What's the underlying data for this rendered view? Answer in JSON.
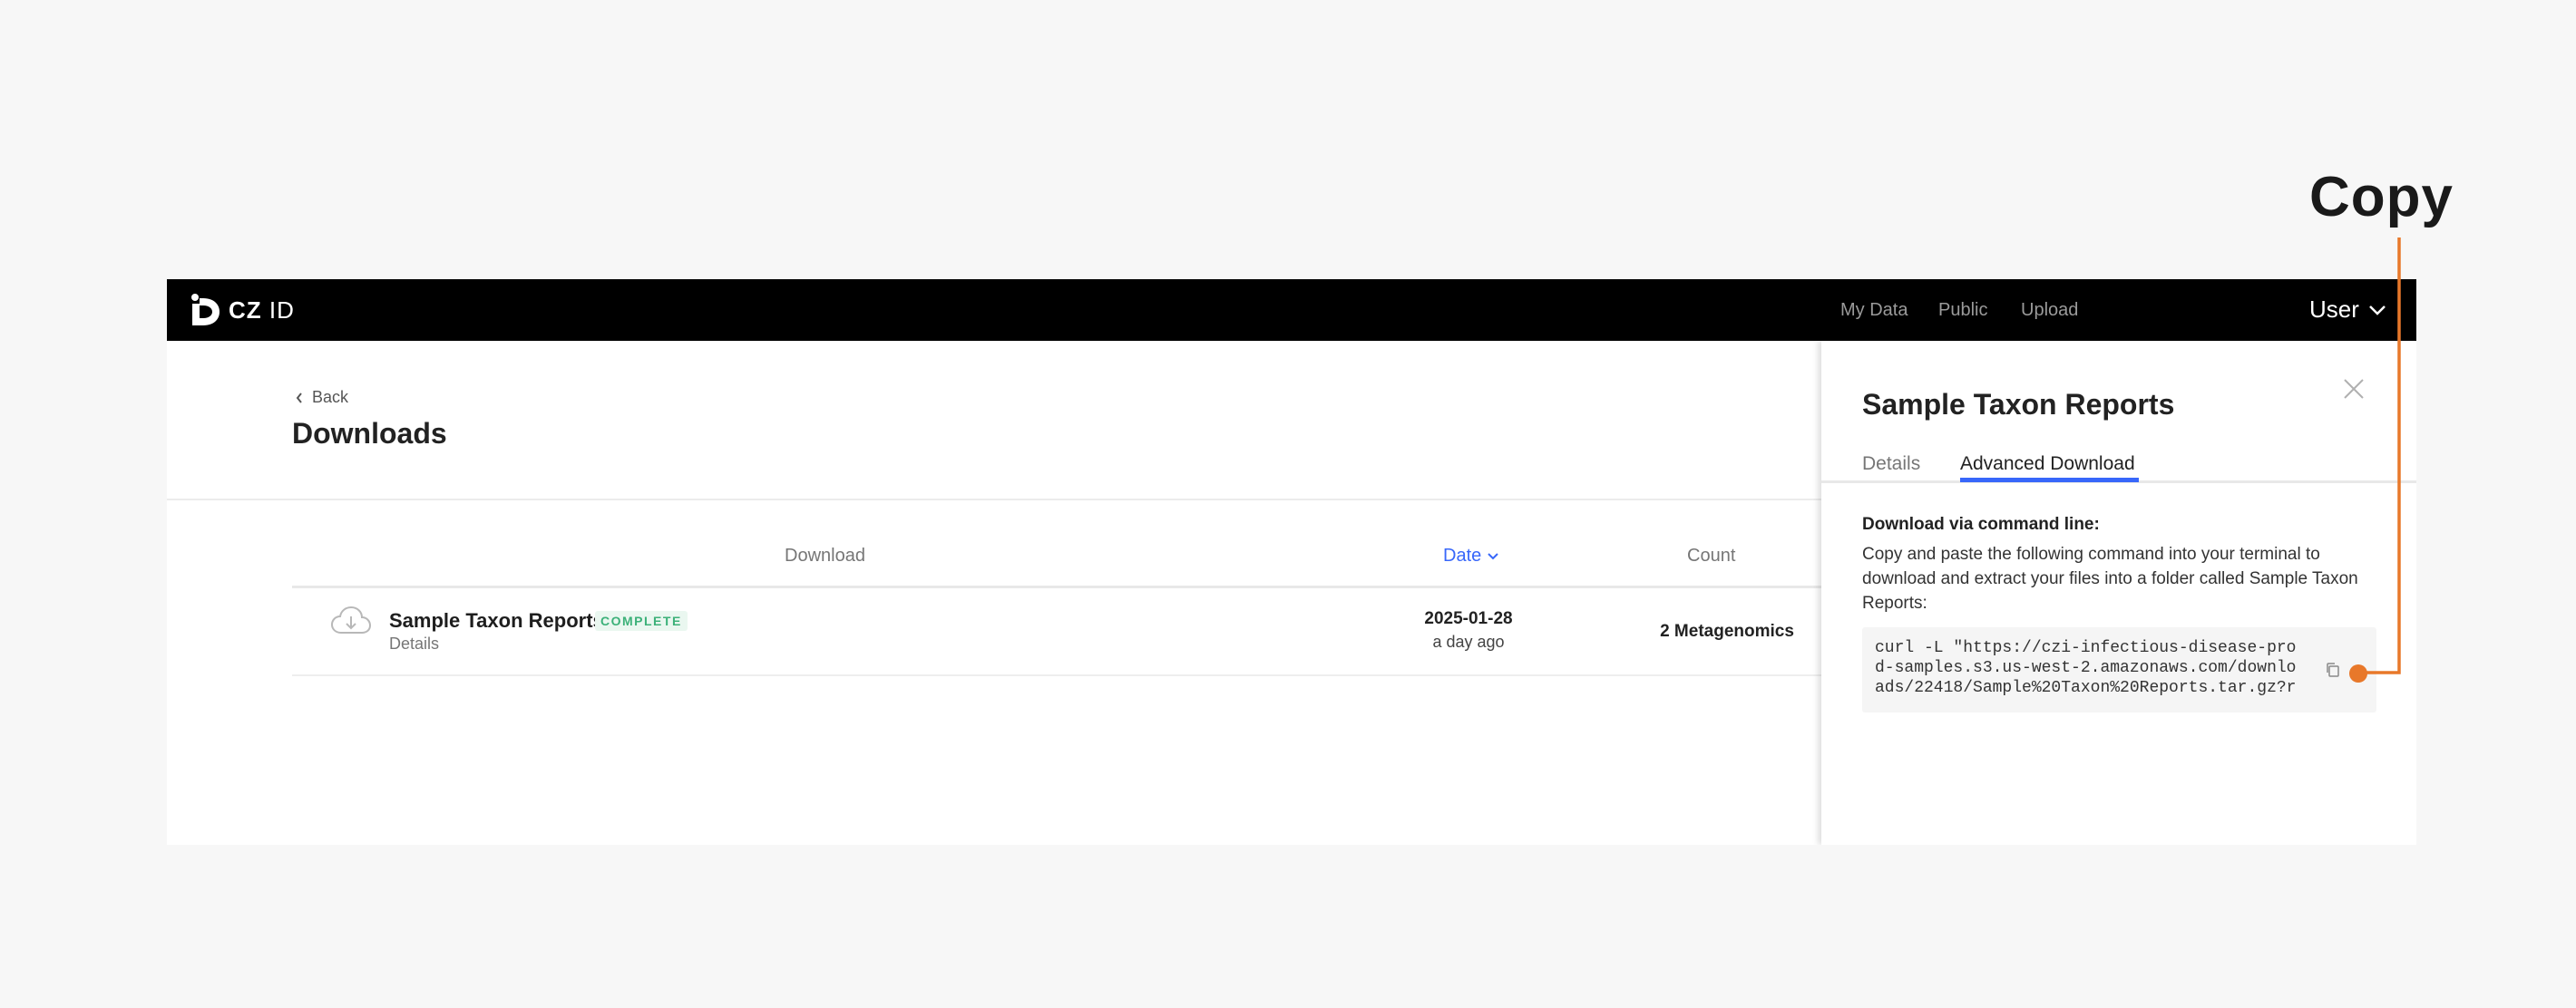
{
  "app": {
    "logo_text": "CZ",
    "logo_suffix": "ID"
  },
  "nav": {
    "links": [
      "My Data",
      "Public",
      "Upload"
    ],
    "user_label": "User"
  },
  "page": {
    "back_label": "Back",
    "title": "Downloads"
  },
  "table": {
    "headers": {
      "download": "Download",
      "date": "Date",
      "count": "Count"
    },
    "rows": [
      {
        "name": "Sample Taxon Reports",
        "status": "COMPLETE",
        "details_link": "Details",
        "date": "2025-01-28",
        "relative_date": "a day ago",
        "count": "2 Metagenomics"
      }
    ]
  },
  "panel": {
    "title": "Sample Taxon Reports",
    "tabs": [
      {
        "label": "Details",
        "active": false
      },
      {
        "label": "Advanced Download",
        "active": true
      }
    ],
    "command_title": "Download via command line:",
    "command_description": "Copy and paste the following command into your terminal to download and extract your files into a folder called Sample Taxon Reports:",
    "command": "curl -L \"https://czi-infectious-disease-prod-samples.s3.us-west-2.amazonaws.com/downloads/22418/Sample%20Taxon%20Reports.tar.gz?r"
  },
  "annotation": {
    "label": "Copy",
    "color": "#e8782a"
  },
  "colors": {
    "accent": "#3867fa",
    "status_complete": "#3cb179",
    "topbar": "#000000"
  }
}
